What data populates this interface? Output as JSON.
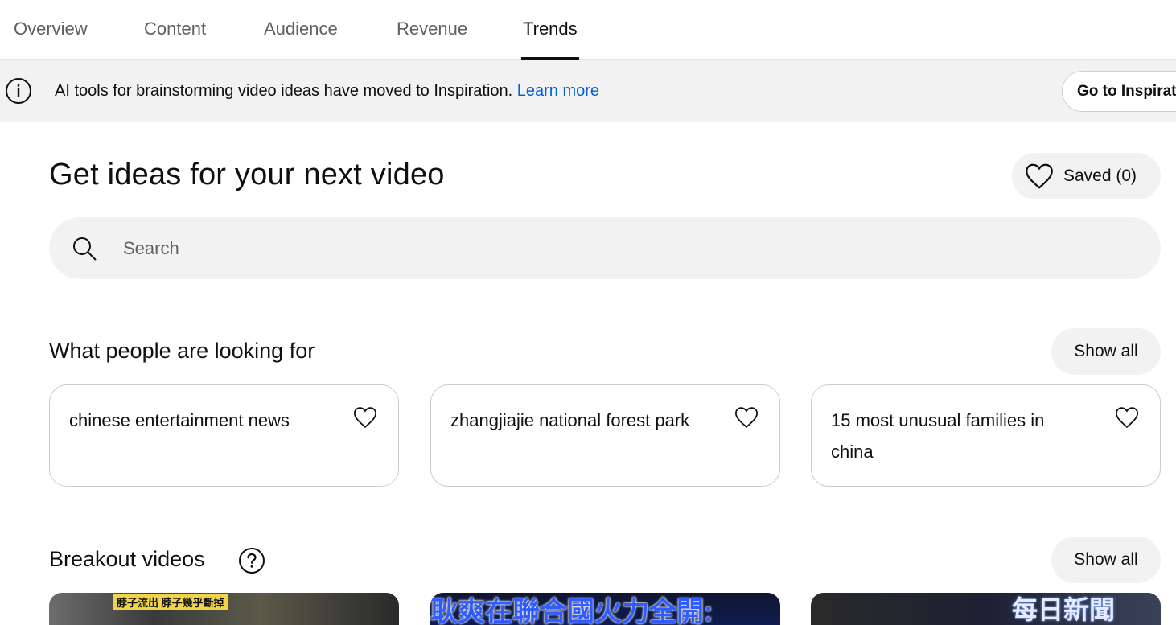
{
  "tabs": [
    {
      "label": "Overview",
      "active": false
    },
    {
      "label": "Content",
      "active": false
    },
    {
      "label": "Audience",
      "active": false
    },
    {
      "label": "Revenue",
      "active": false
    },
    {
      "label": "Trends",
      "active": true
    }
  ],
  "banner": {
    "icon": "info-icon",
    "message": "AI tools for brainstorming video ideas have moved to Inspiration.",
    "link_label": "Learn more",
    "button_label": "Go to Inspiration"
  },
  "page": {
    "title": "Get ideas for your next video",
    "saved_label": "Saved (0)"
  },
  "search": {
    "placeholder": "Search",
    "value": ""
  },
  "looking_for": {
    "title": "What people are looking for",
    "show_all_label": "Show all",
    "cards": [
      {
        "text": "chinese entertainment news"
      },
      {
        "text": "zhangjiajie national forest park"
      },
      {
        "text": "15 most unusual families in china"
      }
    ]
  },
  "breakout": {
    "title": "Breakout videos",
    "help_icon": "question-circle-icon",
    "show_all_label": "Show all",
    "thumbnails": [
      {
        "caption": "脖子流出 脖子幾乎斷掉"
      },
      {
        "caption": "耿爽在聯合國火力全開:"
      },
      {
        "caption": "每日新聞"
      }
    ]
  },
  "colors": {
    "link": "#065fd4",
    "chip_bg": "#f2f2f2",
    "text": "#0f0f0f",
    "secondary_text": "#606060"
  }
}
